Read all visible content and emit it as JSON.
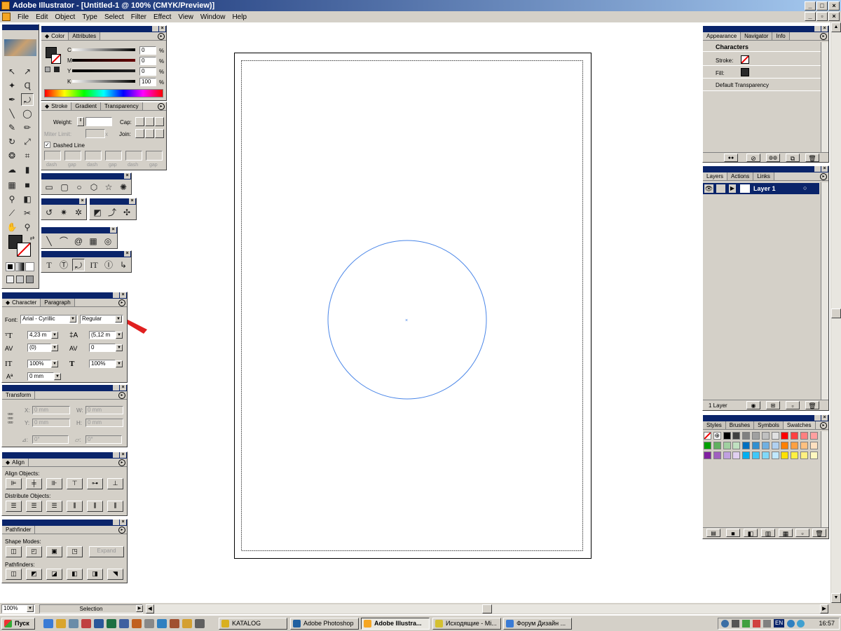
{
  "window": {
    "title": "Adobe Illustrator - [Untitled-1 @ 100% (CMYK/Preview)]"
  },
  "menu": [
    "File",
    "Edit",
    "Object",
    "Type",
    "Select",
    "Filter",
    "Effect",
    "View",
    "Window",
    "Help"
  ],
  "color_panel": {
    "tabs": [
      "Color",
      "Attributes"
    ],
    "channels": [
      {
        "label": "C",
        "value": "0",
        "unit": "%"
      },
      {
        "label": "M",
        "value": "0",
        "unit": "%"
      },
      {
        "label": "Y",
        "value": "0",
        "unit": "%"
      },
      {
        "label": "K",
        "value": "100",
        "unit": "%"
      }
    ]
  },
  "stroke_panel": {
    "tabs": [
      "Stroke",
      "Gradient",
      "Transparency"
    ],
    "weight_label": "Weight:",
    "cap_label": "Cap:",
    "miter_label": "Miter Limit:",
    "miter_unit": "x",
    "join_label": "Join:",
    "dashed_label": "Dashed Line",
    "dash_labels": [
      "dash",
      "gap",
      "dash",
      "gap",
      "dash",
      "gap"
    ]
  },
  "character_panel": {
    "tabs": [
      "Character",
      "Paragraph"
    ],
    "font_label": "Font:",
    "font_value": "Arial - Cyrillic",
    "style_value": "Regular",
    "size_value": "4,23 m",
    "leading_value": "(5,12 m",
    "kerning_value": "(0)",
    "tracking_value": "0",
    "vscale_value": "100%",
    "hscale_value": "100%",
    "baseline_value": "0 mm"
  },
  "transform_panel": {
    "tab": "Transform",
    "x_label": "X:",
    "x_value": "0 mm",
    "y_label": "Y:",
    "y_value": "0 mm",
    "w_label": "W:",
    "w_value": "0 mm",
    "h_label": "H:",
    "h_value": "0 mm",
    "rotate_value": "0°",
    "shear_value": "0°"
  },
  "align_panel": {
    "tab": "Align",
    "align_label": "Align Objects:",
    "distribute_label": "Distribute Objects:"
  },
  "pathfinder_panel": {
    "tab": "Pathfinder",
    "shape_modes_label": "Shape Modes:",
    "expand_label": "Expand",
    "pathfinders_label": "Pathfinders:"
  },
  "appearance_panel": {
    "tabs": [
      "Appearance",
      "Navigator",
      "Info"
    ],
    "header": "Characters",
    "stroke_label": "Stroke:",
    "fill_label": "Fill:",
    "transparency_label": "Default Transparency"
  },
  "layers_panel": {
    "tabs": [
      "Layers",
      "Actions",
      "Links"
    ],
    "layer_name": "Layer 1",
    "count_label": "1 Layer"
  },
  "swatches_panel": {
    "tabs": [
      "Styles",
      "Brushes",
      "Symbols",
      "Swatches"
    ],
    "colors": [
      "#ffffff",
      "#ffffff",
      "#000000",
      "#404040",
      "#808080",
      "#a0a0a0",
      "#c0c0c0",
      "#e0e0e0",
      "#ff0000",
      "#ff4040",
      "#ff8080",
      "#ffa0a0",
      "#00a000",
      "#60b060",
      "#a0d0a0",
      "#c0e0c0",
      "#0070c0",
      "#3090d0",
      "#70b0e0",
      "#b0d0f0",
      "#ff8000",
      "#ffa040",
      "#ffc080",
      "#ffe0c0",
      "#8020a0",
      "#a060c0",
      "#c0a0e0",
      "#e0d0f0",
      "#00b0f0",
      "#40c8f8",
      "#80d8f8",
      "#c0e8ff",
      "#ffe000",
      "#fff040",
      "#fff080",
      "#fff8c0"
    ]
  },
  "status": {
    "zoom": "100%",
    "tool": "Selection"
  },
  "taskbar": {
    "start_label": "Пуск",
    "buttons": [
      "KATALOG",
      "Adobe Photoshop",
      "Adobe Illustra...",
      "Исходящие - Mi...",
      "Форум Дизайн ..."
    ],
    "lang": "EN",
    "clock": "16:57"
  }
}
